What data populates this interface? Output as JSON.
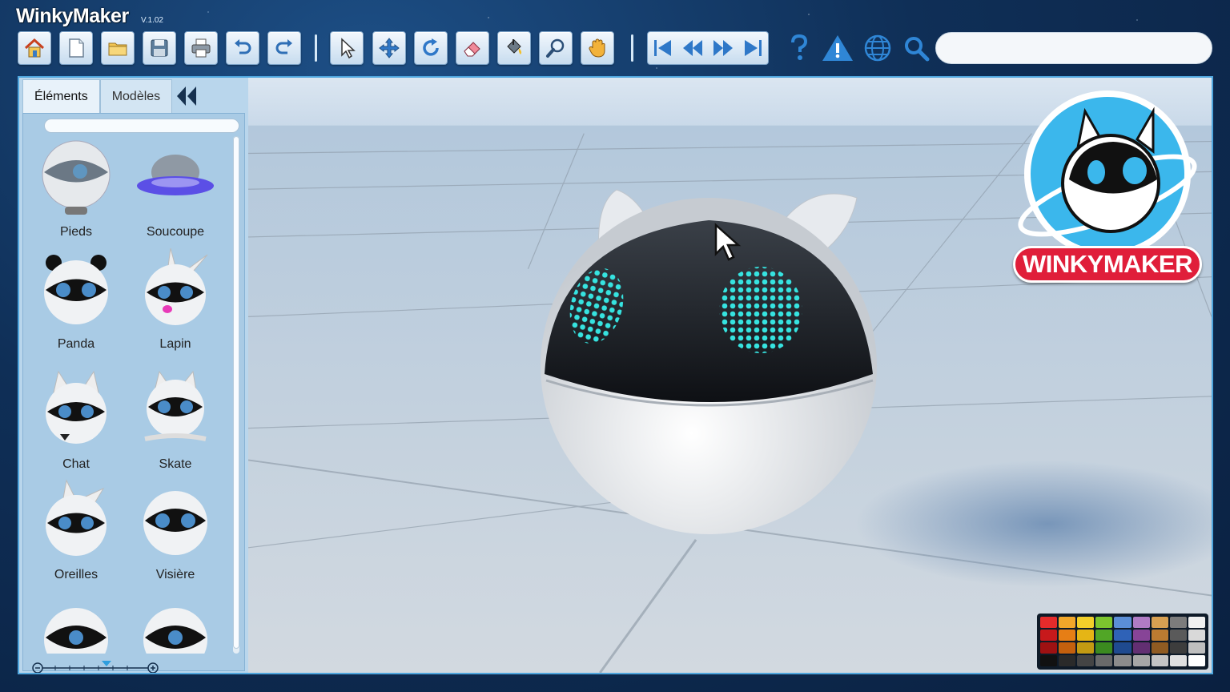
{
  "app": {
    "title": "WinkyMaker",
    "version": "V.1.02"
  },
  "toolbar": {
    "buttons": [
      {
        "icon": "home-icon"
      },
      {
        "icon": "new-file-icon"
      },
      {
        "icon": "open-folder-icon"
      },
      {
        "icon": "save-icon"
      },
      {
        "icon": "print-icon"
      },
      {
        "icon": "undo-icon"
      },
      {
        "icon": "redo-icon"
      },
      {
        "icon": "select-arrow-icon"
      },
      {
        "icon": "move-icon"
      },
      {
        "icon": "rotate-icon"
      },
      {
        "icon": "eraser-icon"
      },
      {
        "icon": "paint-bucket-icon"
      },
      {
        "icon": "zoom-icon"
      },
      {
        "icon": "hand-pan-icon"
      }
    ],
    "nav": [
      "skip-first-icon",
      "rewind-icon",
      "fast-forward-icon",
      "skip-last-icon"
    ],
    "extra": [
      "help-icon",
      "warning-icon",
      "globe-icon",
      "search-icon"
    ]
  },
  "search": {
    "value": "",
    "placeholder": ""
  },
  "panel": {
    "tabs": [
      {
        "label": "Éléments",
        "active": true
      },
      {
        "label": "Modèles",
        "active": false
      }
    ],
    "filter": {
      "value": ""
    },
    "items": [
      {
        "label": "Pieds"
      },
      {
        "label": "Soucoupe"
      },
      {
        "label": "Panda"
      },
      {
        "label": "Lapin"
      },
      {
        "label": "Chat"
      },
      {
        "label": "Skate"
      },
      {
        "label": "Oreilles"
      },
      {
        "label": "Visière"
      },
      {
        "label": ""
      },
      {
        "label": ""
      }
    ]
  },
  "brand": {
    "text": "WINKYMAKER"
  },
  "palette": [
    "#e52b2b",
    "#f2a72a",
    "#f2cf2a",
    "#7cc52e",
    "#5b8ed6",
    "#b07bc4",
    "#d8a052",
    "#7c7c7c",
    "#f0f0f0",
    "#c7191b",
    "#e67e15",
    "#e5b515",
    "#51a626",
    "#2f62b7",
    "#874497",
    "#bb7b31",
    "#5a5a5a",
    "#d9d9d9",
    "#9e1112",
    "#c4600d",
    "#c39a12",
    "#3b8a1f",
    "#1f4a8f",
    "#622f72",
    "#8f5b22",
    "#3d3d3d",
    "#bfbfbf",
    "#111111",
    "#2a2a2a",
    "#444444",
    "#6a6a6a",
    "#8c8c8c",
    "#a6a6a6",
    "#c4c4c4",
    "#e0e0e0",
    "#ffffff"
  ],
  "colors": {
    "accent": "#4fa6de",
    "eye_led": "#36e3e0",
    "brand_red": "#e01e3a"
  }
}
